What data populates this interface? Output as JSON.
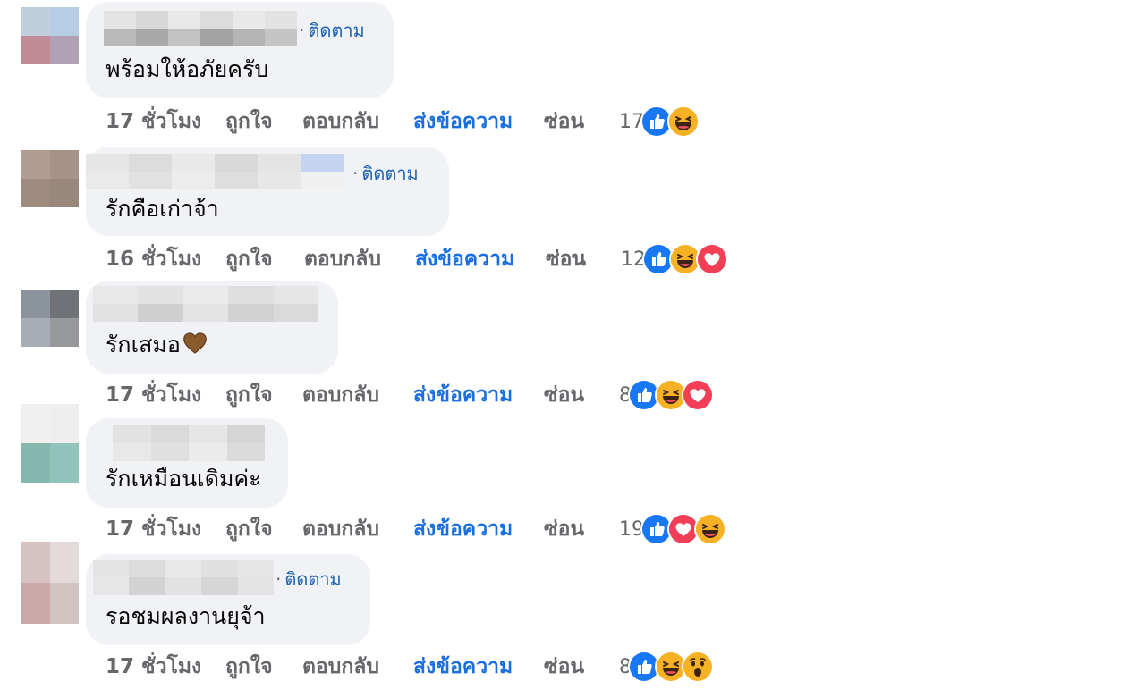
{
  "comments": [
    {
      "text": "พร้อมให้อภัยครับ",
      "follow_label": "ติดตาม",
      "show_follow": true,
      "time": "17 ชั่วโมง",
      "like": "ถูกใจ",
      "reply": "ตอบกลับ",
      "send_message": "ส่งข้อความ",
      "hide": "ซ่อน",
      "reaction_count": "17",
      "reactions": [
        "like-icon",
        "haha-icon"
      ]
    },
    {
      "text": "รักคือเก่าจ้า",
      "follow_label": "ติดตาม",
      "show_follow": true,
      "time": "16 ชั่วโมง",
      "like": "ถูกใจ",
      "reply": "ตอบกลับ",
      "send_message": "ส่งข้อความ",
      "hide": "ซ่อน",
      "reaction_count": "12",
      "reactions": [
        "like-icon",
        "haha-icon",
        "love-icon"
      ]
    },
    {
      "text": "รักเสมอ",
      "emoji": "brown-heart-icon",
      "show_follow": false,
      "time": "17 ชั่วโมง",
      "like": "ถูกใจ",
      "reply": "ตอบกลับ",
      "send_message": "ส่งข้อความ",
      "hide": "ซ่อน",
      "reaction_count": "8",
      "reactions": [
        "like-icon",
        "haha-icon",
        "love-icon"
      ]
    },
    {
      "text": "รักเหมือนเดิมค่ะ",
      "show_follow": false,
      "time": "17 ชั่วโมง",
      "like": "ถูกใจ",
      "reply": "ตอบกลับ",
      "send_message": "ส่งข้อความ",
      "hide": "ซ่อน",
      "reaction_count": "19",
      "reactions": [
        "like-icon",
        "love-icon",
        "haha-icon"
      ]
    },
    {
      "text": "รอชมผลงานยุจ้า",
      "follow_label": "ติดตาม",
      "show_follow": true,
      "time": "17 ชั่วโมง",
      "like": "ถูกใจ",
      "reply": "ตอบกลับ",
      "send_message": "ส่งข้อความ",
      "hide": "ซ่อน",
      "reaction_count": "8",
      "reactions": [
        "like-icon",
        "haha-icon",
        "wow-icon"
      ]
    }
  ],
  "colors": {
    "bubble": "#f0f2f5",
    "link_blue": "#1a6fe0",
    "muted_text": "#65676b",
    "like_blue": "#1877f2",
    "love_red": "#f33e58",
    "haha_yellow": "#f7b125"
  }
}
